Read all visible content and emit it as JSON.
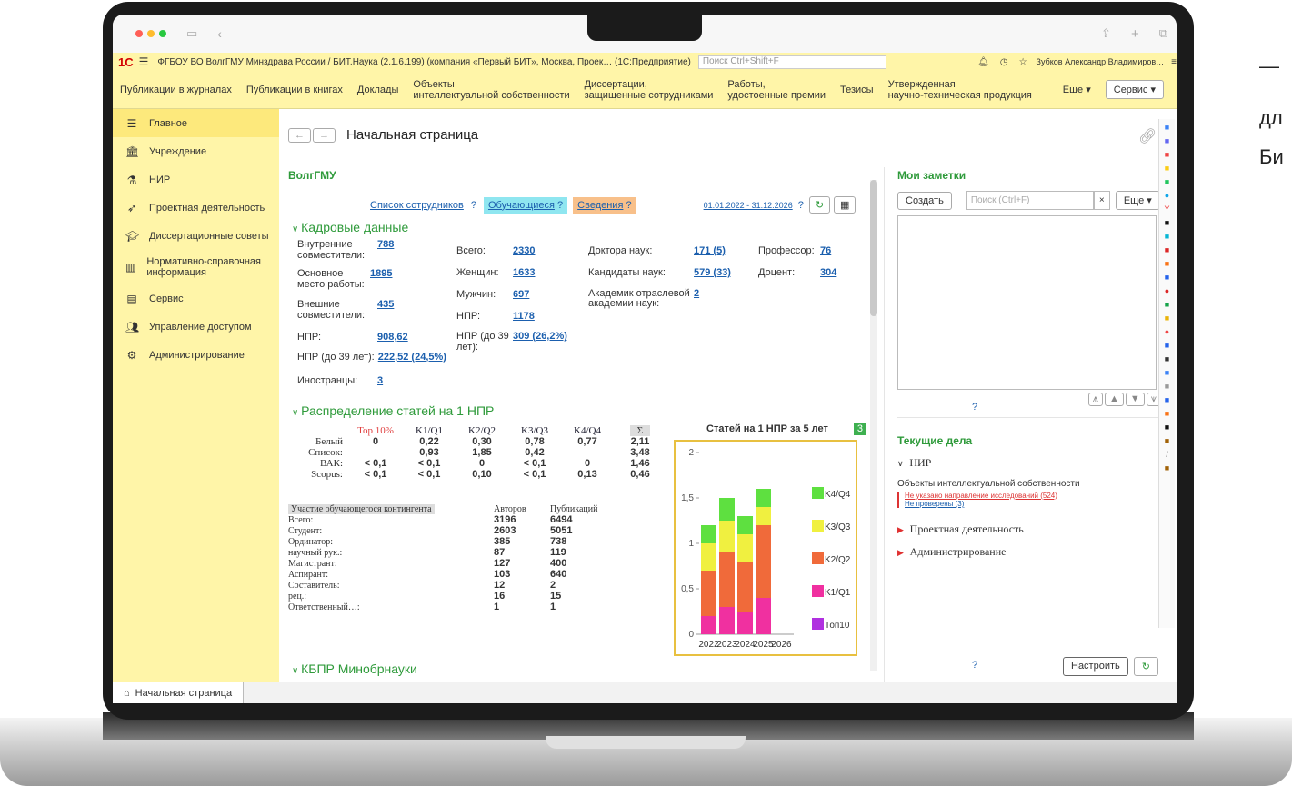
{
  "side_text": [
    "—",
    "дл",
    "Би"
  ],
  "titlebar": {
    "text": "ФГБОУ ВО ВолгГМУ Минздрава России / БИТ.Наука (2.1.6.199) (компания «Первый БИТ», Москва, Проек…  (1С:Предприятие)",
    "search_placeholder": "Поиск Ctrl+Shift+F",
    "user": "Зубков Александр Владимиров…"
  },
  "menu": {
    "items": [
      "Публикации в журналах",
      "Публикации в книгах",
      "Доклады",
      "Объекты\nинтеллектуальной собственности",
      "Диссертации,\nзащищенные сотрудниками",
      "Работы,\nудостоенные премии",
      "Тезисы",
      "Утвержденная\nнаучно-техническая продукция"
    ],
    "more": "Еще ▾",
    "service": "Сервис ▾"
  },
  "sidebar": {
    "items": [
      {
        "label": "Главное",
        "icon": "list-icon"
      },
      {
        "label": "Учреждение",
        "icon": "building-icon"
      },
      {
        "label": "НИР",
        "icon": "flask-icon"
      },
      {
        "label": "Проектная деятельность",
        "icon": "rocket-icon"
      },
      {
        "label": "Диссертационные советы",
        "icon": "mortarboard-icon"
      },
      {
        "label": "Нормативно-справочная информация",
        "icon": "books-icon"
      },
      {
        "label": "Сервис",
        "icon": "service-icon"
      },
      {
        "label": "Управление доступом",
        "icon": "users-icon"
      },
      {
        "label": "Администрирование",
        "icon": "gear-icon"
      }
    ]
  },
  "page": {
    "title": "Начальная страница",
    "org": "ВолгГМУ"
  },
  "links": {
    "staff": "Список сотрудников",
    "students": "Обучающиеся",
    "info": "Сведения",
    "q": "?",
    "period": "01.01.2022 - 31.12.2026"
  },
  "kadr": {
    "heading": "Кадровые данные",
    "col1": [
      [
        "Внутренние совместители:",
        "788"
      ],
      [
        "Основное место работы:",
        "1895"
      ],
      [
        "Внешние совместители:",
        "435"
      ],
      [
        "НПР:",
        "908,62"
      ],
      [
        "НПР (до 39 лет):",
        "222,52 (24,5%)"
      ],
      [
        "Иностранцы:",
        "3"
      ]
    ],
    "col2": [
      [
        "Всего:",
        "2330"
      ],
      [
        "Женщин:",
        "1633"
      ],
      [
        "Мужчин:",
        "697"
      ],
      [
        "НПР:",
        "1178"
      ],
      [
        "НПР (до 39 лет):",
        "309 (26,2%)"
      ]
    ],
    "col3": [
      [
        "Доктора наук:",
        "171 (5)"
      ],
      [
        "Кандидаты наук:",
        "579 (33)"
      ],
      [
        "Академик отраслевой академии наук:",
        "2"
      ]
    ],
    "col4": [
      [
        "Профессор:",
        "76"
      ],
      [
        "Доцент:",
        "304"
      ]
    ]
  },
  "dist": {
    "heading": "Распределение статей на 1 НПР",
    "headers": [
      "Top 10%",
      "K1/Q1",
      "K2/Q2",
      "K3/Q3",
      "K4/Q4",
      "Σ"
    ],
    "rows": [
      [
        "Белый",
        "0",
        "0,22",
        "0,30",
        "0,78",
        "0,77",
        "2,11"
      ],
      [
        "Список:",
        "",
        "0,93",
        "1,85",
        "0,42",
        "",
        "3,48"
      ],
      [
        "ВАК:",
        "< 0,1",
        "< 0,1",
        "0",
        "< 0,1",
        "0",
        "1,46"
      ],
      [
        "Scopus:",
        "< 0,1",
        "< 0,1",
        "0,10",
        "< 0,1",
        "0,13",
        "0,46"
      ]
    ]
  },
  "students": {
    "header": [
      "Участие обучающегося контингента",
      "Авторов",
      "Публикаций"
    ],
    "rows": [
      [
        "Всего:",
        "3196",
        "6494"
      ],
      [
        "Студент:",
        "2603",
        "5051"
      ],
      [
        "Ординатор:",
        "385",
        "738"
      ],
      [
        "научный рук.:",
        "87",
        "119"
      ],
      [
        "Магистрант:",
        "127",
        "400"
      ],
      [
        "Аспирант:",
        "103",
        "640"
      ],
      [
        "Составитель:",
        "12",
        "2"
      ],
      [
        "рец.:",
        "16",
        "15"
      ],
      [
        "Ответственный…:",
        "1",
        "1"
      ]
    ]
  },
  "kbpr": "КБПР Минобрнауки",
  "chart_data": {
    "type": "bar",
    "title": "Статей на 1 НПР за 5 лет",
    "badge": "3",
    "categories": [
      "2022",
      "2023",
      "2024",
      "2025",
      "2026"
    ],
    "series": [
      {
        "name": "Топ10",
        "color": "#b030e0",
        "values": [
          0,
          0,
          0,
          0,
          0
        ]
      },
      {
        "name": "K1/Q1",
        "color": "#f030a0",
        "values": [
          0.2,
          0.3,
          0.25,
          0.4,
          0
        ]
      },
      {
        "name": "K2/Q2",
        "color": "#f06a3a",
        "values": [
          0.5,
          0.6,
          0.55,
          0.8,
          0
        ]
      },
      {
        "name": "K3/Q3",
        "color": "#f0f040",
        "values": [
          0.3,
          0.35,
          0.3,
          0.2,
          0
        ]
      },
      {
        "name": "K4/Q4",
        "color": "#5ee040",
        "values": [
          0.2,
          0.25,
          0.2,
          0.2,
          0
        ]
      }
    ],
    "ylim": [
      0,
      2
    ],
    "yticks": [
      "0",
      "0,5",
      "1",
      "1,5",
      "2"
    ]
  },
  "notes": {
    "title": "Мои заметки",
    "create": "Создать",
    "search_placeholder": "Поиск (Ctrl+F)",
    "more": "Еще ▾"
  },
  "tasks": {
    "title": "Текущие дела",
    "nir": "НИР",
    "obj": "Объекты интеллектуальной собственности",
    "link1": "Не указано направление исследований (524)",
    "link2": "Не проверены (3)",
    "project": "Проектная деятельность",
    "admin": "Администрирование",
    "setup": "Настроить"
  },
  "bottom": {
    "tab": "Начальная страница"
  }
}
